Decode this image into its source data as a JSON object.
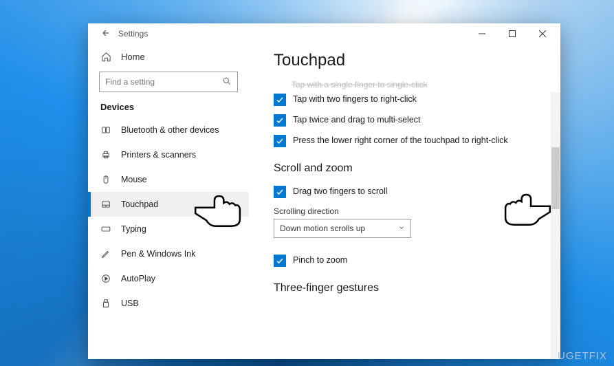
{
  "window": {
    "title": "Settings",
    "home": "Home",
    "search_placeholder": "Find a setting"
  },
  "sidebar": {
    "section": "Devices",
    "items": [
      {
        "label": "Bluetooth & other devices"
      },
      {
        "label": "Printers & scanners"
      },
      {
        "label": "Mouse"
      },
      {
        "label": "Touchpad"
      },
      {
        "label": "Typing"
      },
      {
        "label": "Pen & Windows Ink"
      },
      {
        "label": "AutoPlay"
      },
      {
        "label": "USB"
      }
    ]
  },
  "main": {
    "heading": "Touchpad",
    "cutoff": "Tap with a single finger to single-click",
    "check1": "Tap with two fingers to right-click",
    "check2": "Tap twice and drag to multi-select",
    "check3": "Press the lower right corner of the touchpad to right-click",
    "scroll_zoom": "Scroll and zoom",
    "check4": "Drag two fingers to scroll",
    "dir_label": "Scrolling direction",
    "dir_value": "Down motion scrolls up",
    "check5": "Pinch to zoom",
    "three_finger": "Three-finger gestures"
  },
  "watermark": "UGETFIX"
}
